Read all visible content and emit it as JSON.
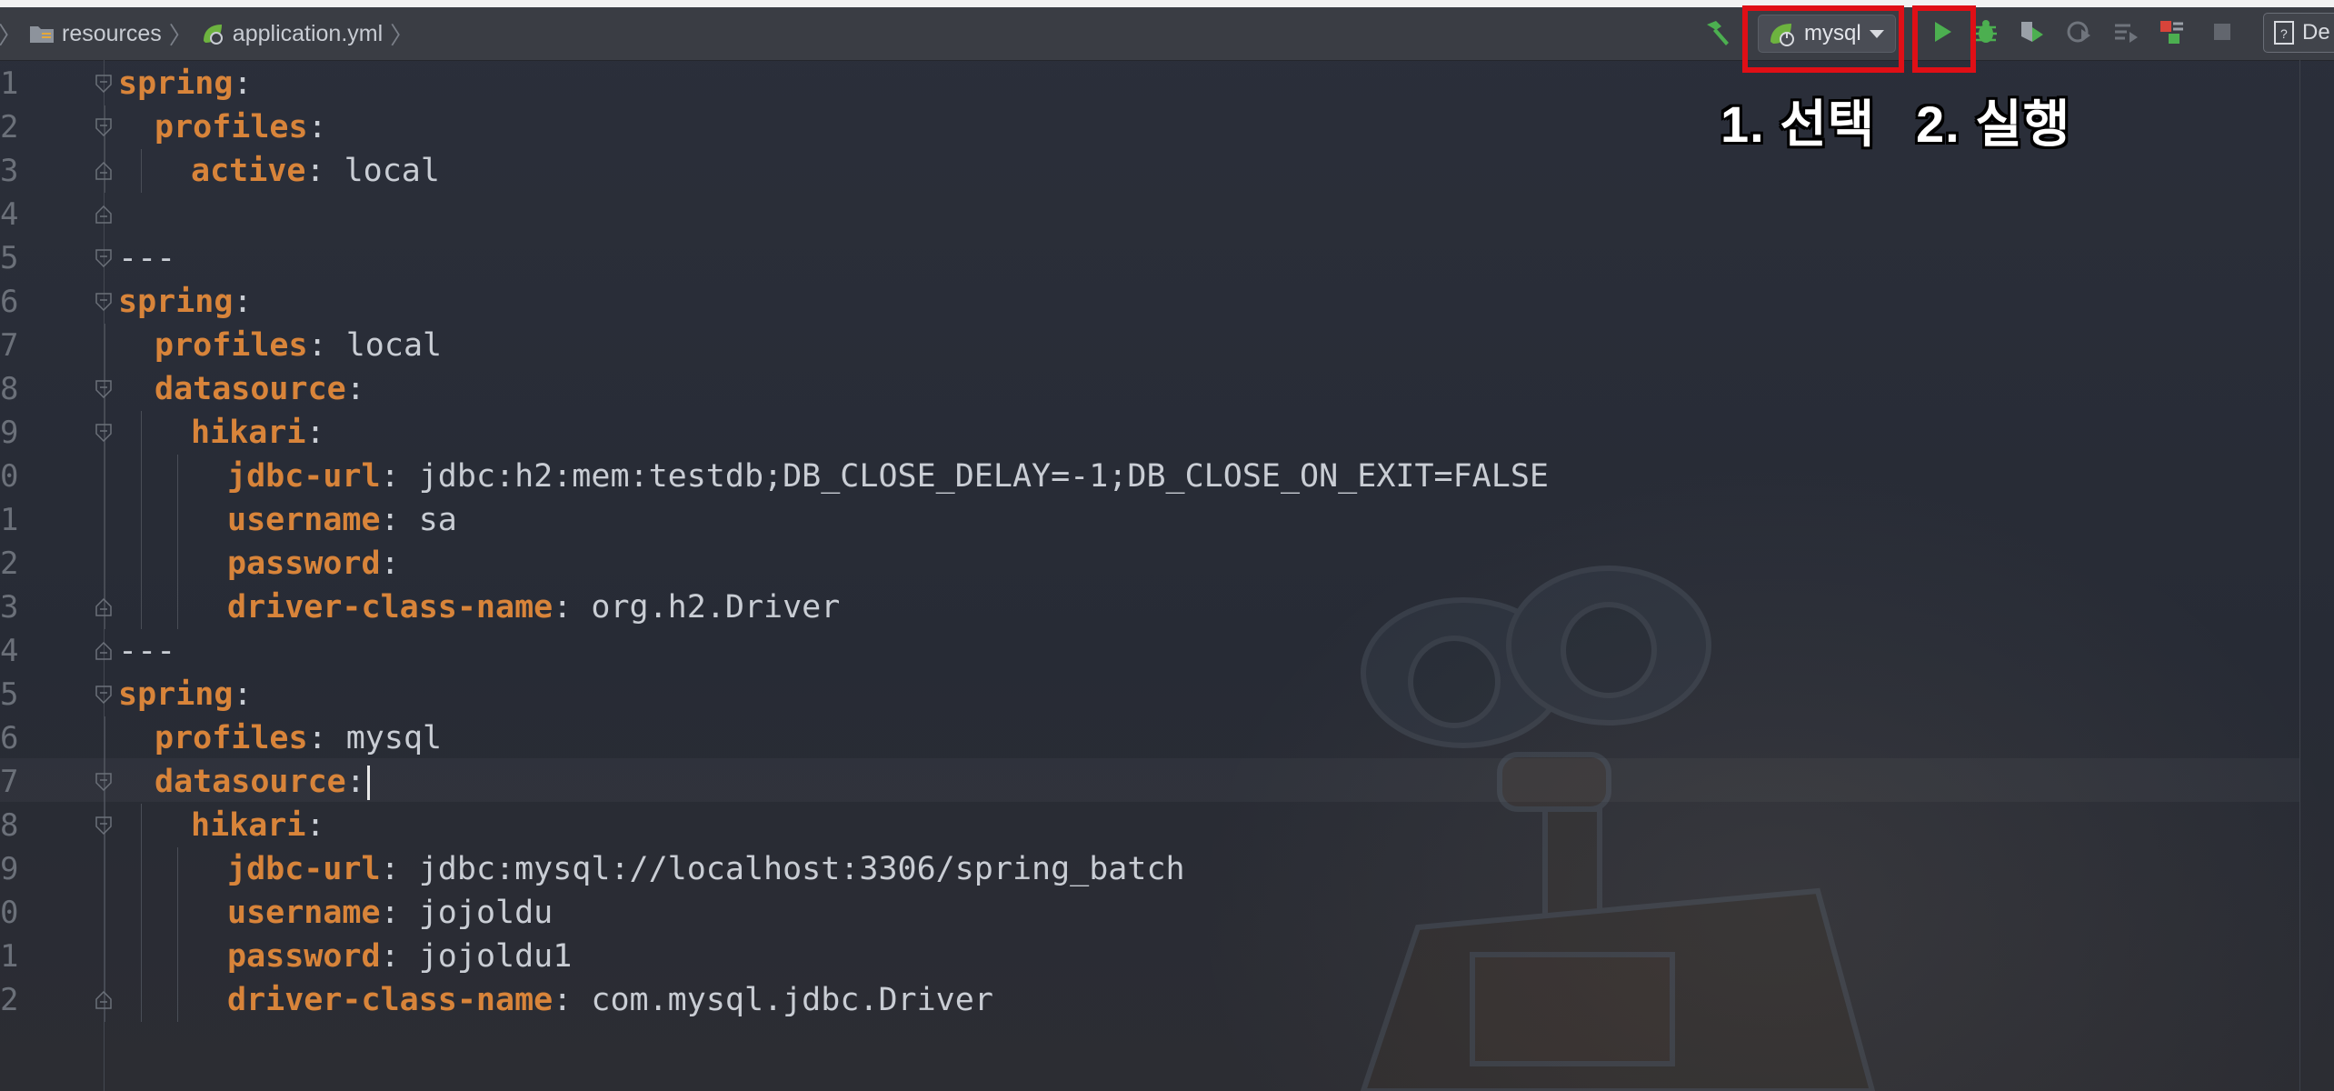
{
  "breadcrumb": {
    "items": [
      "resources",
      "application.yml"
    ]
  },
  "toolbar": {
    "run_config": "mysql",
    "right_button_label": "De"
  },
  "annotations": {
    "step1": "1. 선택",
    "step2": "2. 실행"
  },
  "colors": {
    "accent_red": "#e00f16",
    "key_orange": "#d8843a",
    "run_green": "#4caf50"
  },
  "editor": {
    "line_numbers": [
      "1",
      "2",
      "3",
      "4",
      "5",
      "6",
      "7",
      "8",
      "9",
      "0",
      "1",
      "2",
      "3",
      "4",
      "5",
      "6",
      "7",
      "8",
      "9",
      "0",
      "1",
      "2"
    ],
    "lines": [
      {
        "key": "spring",
        "sep": ":",
        "value": ""
      },
      {
        "key": "profiles",
        "sep": ":",
        "value": ""
      },
      {
        "key": "active",
        "sep": ":",
        "value": " local"
      },
      {
        "key": "",
        "sep": "",
        "value": ""
      },
      {
        "key": "",
        "sep": "",
        "value": "---"
      },
      {
        "key": "spring",
        "sep": ":",
        "value": ""
      },
      {
        "key": "profiles",
        "sep": ":",
        "value": " local"
      },
      {
        "key": "datasource",
        "sep": ":",
        "value": ""
      },
      {
        "key": "hikari",
        "sep": ":",
        "value": ""
      },
      {
        "key": "jdbc-url",
        "sep": ":",
        "value": " jdbc:h2:mem:testdb;DB_CLOSE_DELAY=-1;DB_CLOSE_ON_EXIT=FALSE"
      },
      {
        "key": "username",
        "sep": ":",
        "value": " sa"
      },
      {
        "key": "password",
        "sep": ":",
        "value": ""
      },
      {
        "key": "driver-class-name",
        "sep": ":",
        "value": " org.h2.Driver"
      },
      {
        "key": "",
        "sep": "",
        "value": "---"
      },
      {
        "key": "spring",
        "sep": ":",
        "value": ""
      },
      {
        "key": "profiles",
        "sep": ":",
        "value": " mysql"
      },
      {
        "key": "datasource",
        "sep": ":",
        "value": ""
      },
      {
        "key": "hikari",
        "sep": ":",
        "value": ""
      },
      {
        "key": "jdbc-url",
        "sep": ":",
        "value": " jdbc:mysql://localhost:3306/spring_batch"
      },
      {
        "key": "username",
        "sep": ":",
        "value": " jojoldu"
      },
      {
        "key": "password",
        "sep": ":",
        "value": " jojoldu1"
      },
      {
        "key": "driver-class-name",
        "sep": ":",
        "value": " com.mysql.jdbc.Driver"
      }
    ]
  }
}
